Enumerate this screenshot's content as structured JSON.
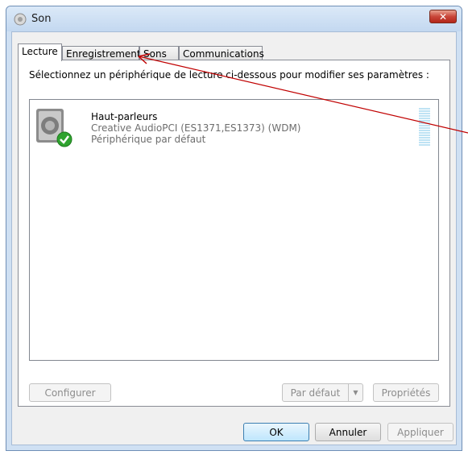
{
  "window": {
    "title": "Son",
    "close_symbol": "✕"
  },
  "tabs": [
    {
      "label": "Lecture",
      "active": true
    },
    {
      "label": "Enregistrement",
      "active": false
    },
    {
      "label": "Sons",
      "active": false
    },
    {
      "label": "Communications",
      "active": false
    }
  ],
  "panel": {
    "instruction": "Sélectionnez un périphérique de lecture ci-dessous pour modifier ses paramètres :"
  },
  "device": {
    "name": "Haut-parleurs",
    "description": "Creative AudioPCI (ES1371,ES1373) (WDM)",
    "status": "Périphérique par défaut",
    "icon": "speaker-icon",
    "badge": "default-check-icon"
  },
  "panel_buttons": {
    "configure": "Configurer",
    "set_default": "Par défaut",
    "properties": "Propriétés"
  },
  "dialog_buttons": {
    "ok": "OK",
    "cancel": "Annuler",
    "apply": "Appliquer"
  },
  "colors": {
    "arrow": "#c00000",
    "meter": "#bfe3f4",
    "check": "#2fa32f"
  }
}
